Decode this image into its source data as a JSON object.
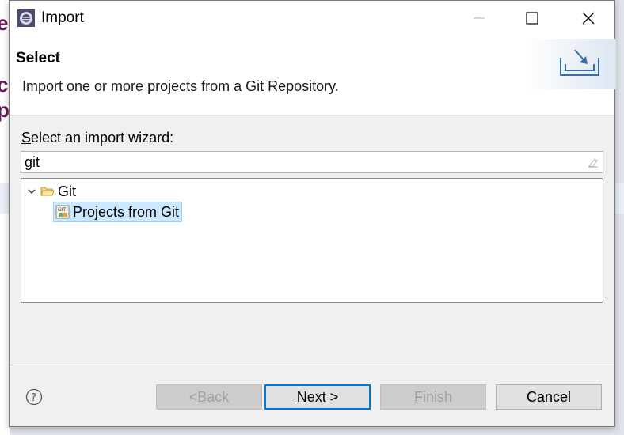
{
  "window": {
    "title": "Import"
  },
  "banner": {
    "title": "Select",
    "description": "Import one or more projects from a Git Repository."
  },
  "wizard": {
    "label_first": "S",
    "label_rest": "elect an import wizard:",
    "filter_value": "git"
  },
  "tree": {
    "items": [
      {
        "label": "Git",
        "expanded": true,
        "icon": "folder-open-icon"
      },
      {
        "label": "Projects from Git",
        "selected": true,
        "icon": "git-project-icon"
      }
    ]
  },
  "buttons": {
    "back_prefix": "< ",
    "back_underlined": "B",
    "back_rest": "ack",
    "next_underlined": "N",
    "next_rest": "ext >",
    "finish_underlined": "F",
    "finish_rest": "inish",
    "cancel": "Cancel"
  },
  "colors": {
    "selection_bg": "#cce8ff",
    "default_button_border": "#0078d7"
  }
}
